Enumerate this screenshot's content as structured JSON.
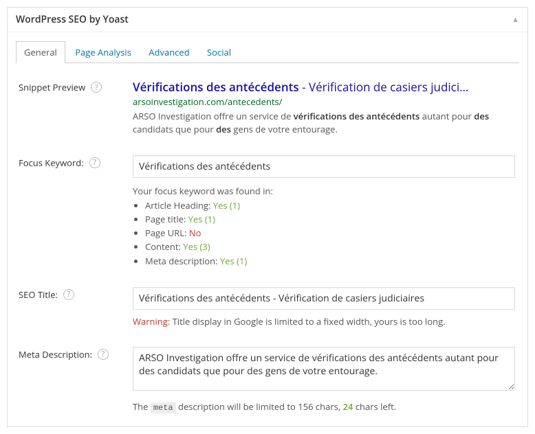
{
  "header": {
    "title": "WordPress SEO by Yoast"
  },
  "tabs": {
    "general": "General",
    "page_analysis": "Page Analysis",
    "advanced": "Advanced",
    "social": "Social"
  },
  "snippet": {
    "label": "Snippet Preview",
    "title_bold": "Vérifications des antécédents",
    "title_sep": " - ",
    "title_rest": "Vérification de casiers judici…",
    "url": "arsoinvestigation.com/antecedents/",
    "desc_p1": "ARSO Investigation offre un service de ",
    "desc_b1": "vérifications des antécédents",
    "desc_p2": " autant pour ",
    "desc_b2": "des",
    "desc_p3": " candidats que pour ",
    "desc_b3": "des",
    "desc_p4": " gens de votre entourage."
  },
  "focus": {
    "label": "Focus Keyword:",
    "value": "Vérifications des antécédents",
    "intro": "Your focus keyword was found in:",
    "items": [
      {
        "name": "Article Heading:",
        "status": "Yes (1)",
        "ok": true
      },
      {
        "name": "Page title:",
        "status": "Yes (1)",
        "ok": true
      },
      {
        "name": "Page URL:",
        "status": "No",
        "ok": false
      },
      {
        "name": "Content:",
        "status": "Yes (3)",
        "ok": true
      },
      {
        "name": "Meta description:",
        "status": "Yes (1)",
        "ok": true
      }
    ]
  },
  "seo_title": {
    "label": "SEO Title:",
    "value": "Vérifications des antécédents - Vérification de casiers judiciaires",
    "warn_label": "Warning:",
    "warn_text": " Title display in Google is limited to a fixed width, yours is too long."
  },
  "meta_desc": {
    "label": "Meta Description:",
    "value": "ARSO Investigation offre un service de vérifications des antécédents autant pour des candidats que pour des gens de votre entourage.",
    "note_p1": "The ",
    "note_code": "meta",
    "note_p2": " description will be limited to 156 chars, ",
    "note_count": "24",
    "note_p3": " chars left."
  }
}
